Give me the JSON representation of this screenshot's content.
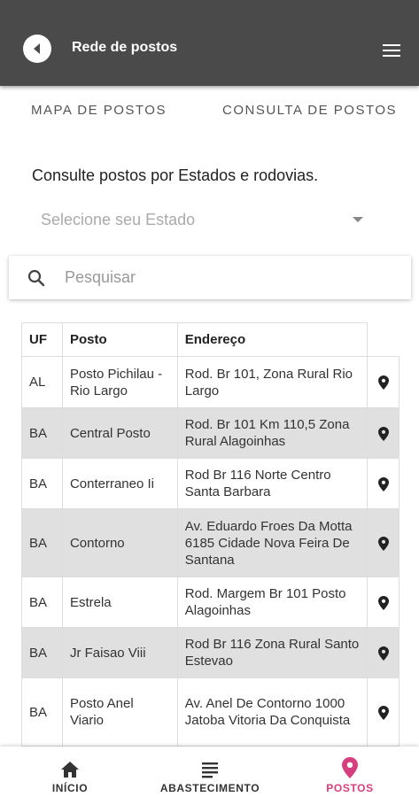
{
  "appbar": {
    "title": "Rede de postos"
  },
  "tabs": [
    {
      "label": "MAPA DE POSTOS"
    },
    {
      "label": "CONSULTA DE POSTOS"
    }
  ],
  "consulta": {
    "subtitle": "Consulte postos por Estados e rodovias.",
    "state_placeholder": "Selecione seu Estado",
    "search_placeholder": "Pesquisar"
  },
  "table": {
    "headers": {
      "uf": "UF",
      "posto": "Posto",
      "endereco": "Endereço"
    },
    "rows": [
      {
        "uf": "AL",
        "posto": "Posto Pichilau - Rio Largo",
        "endereco": "Rod. Br 101, Zona Rural Rio Largo"
      },
      {
        "uf": "BA",
        "posto": "Central Posto",
        "endereco": "Rod. Br 101 Km 110,5 Zona Rural Alagoinhas"
      },
      {
        "uf": "BA",
        "posto": "Conterraneo Ii",
        "endereco": "Rod Br 116 Norte Centro Santa Barbara"
      },
      {
        "uf": "BA",
        "posto": "Contorno",
        "endereco": "Av. Eduardo Froes Da Motta 6185 Cidade Nova Feira De Santana"
      },
      {
        "uf": "BA",
        "posto": "Estrela",
        "endereco": "Rod. Margem Br 101 Posto Alagoinhas"
      },
      {
        "uf": "BA",
        "posto": "Jr Faisao Viii",
        "endereco": "Rod Br 116 Zona Rural Santo Estevao"
      },
      {
        "uf": "BA",
        "posto": "Posto Anel Viario",
        "endereco": "Av. Anel De Contorno 1000 Jatoba Vitoria Da Conquista"
      }
    ]
  },
  "bottom_nav": {
    "items": [
      {
        "label": "INÍCIO",
        "icon": "home-icon"
      },
      {
        "label": "ABASTECIMENTO",
        "icon": "list-icon"
      },
      {
        "label": "POSTOS",
        "icon": "map-pin-icon"
      }
    ],
    "active": "POSTOS"
  },
  "colors": {
    "appbar": "#4a4a4a",
    "accent": "#d63f7e",
    "row_alt": "#e0e0e0"
  }
}
